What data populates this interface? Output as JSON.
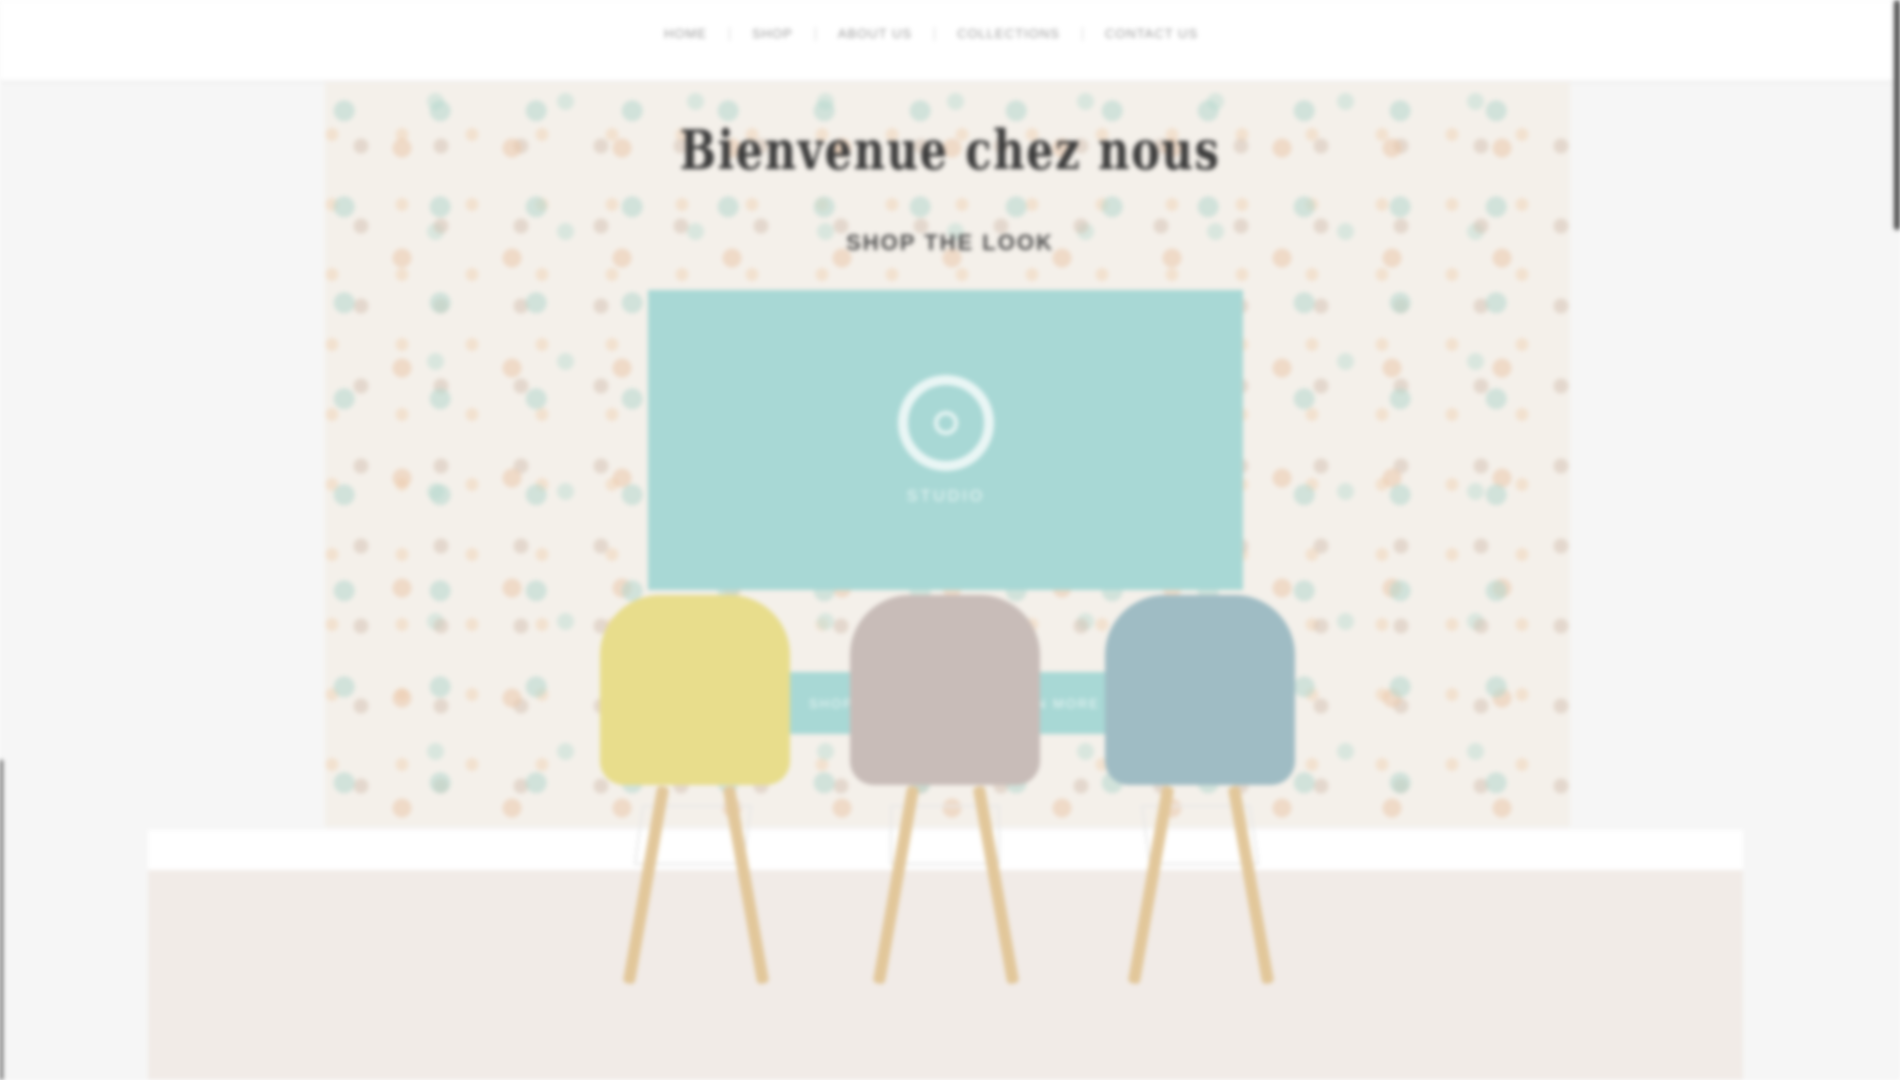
{
  "nav": {
    "items": [
      {
        "label": "HOME"
      },
      {
        "label": "SHOP"
      },
      {
        "label": "ABOUT US"
      },
      {
        "label": "COLLECTIONS"
      },
      {
        "label": "CONTACT US"
      }
    ]
  },
  "hero": {
    "title": "Bienvenue chez nous",
    "subtitle": "SHOP THE LOOK",
    "logo_text": "STUDIO",
    "cta_primary": "SHOP NOW",
    "cta_secondary": "LEARN MORE"
  },
  "colors": {
    "accent": "#a8d8d5",
    "chair_yellow": "#e8dd8c",
    "chair_taupe": "#c8bcb8",
    "chair_blue": "#9fbcc4",
    "leg_wood": "#e2c79a"
  }
}
